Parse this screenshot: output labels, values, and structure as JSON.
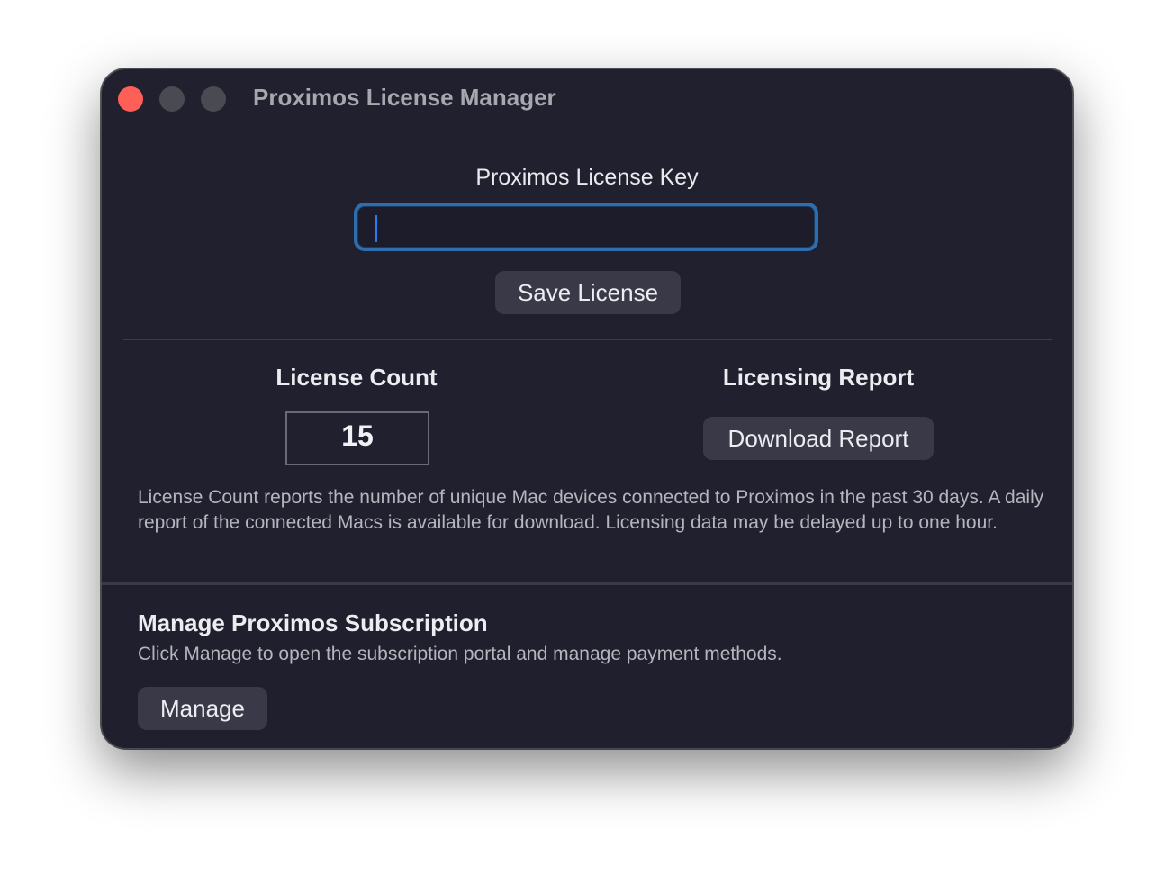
{
  "window": {
    "title": "Proximos License Manager"
  },
  "license_key": {
    "label": "Proximos License Key",
    "value": "",
    "placeholder": "",
    "save_label": "Save License"
  },
  "license_count": {
    "heading": "License Count",
    "value": "15"
  },
  "licensing_report": {
    "heading": "Licensing Report",
    "button_label": "Download Report"
  },
  "description": "License Count reports the number of unique Mac devices connected to Proximos in the past 30 days. A daily report of the connected Macs is available for download. Licensing data may be delayed up to one hour.",
  "subscription": {
    "heading": "Manage Proximos Subscription",
    "description": "Click Manage to open the subscription portal and manage payment methods.",
    "button_label": "Manage"
  },
  "colors": {
    "background": "#21202f",
    "focus_ring": "#2f6eae",
    "caret": "#2a7cf6",
    "close_button": "#fe5f57"
  },
  "icons": {
    "close": "close-traffic-light",
    "minimize": "minimize-traffic-light",
    "maximize": "maximize-traffic-light"
  }
}
